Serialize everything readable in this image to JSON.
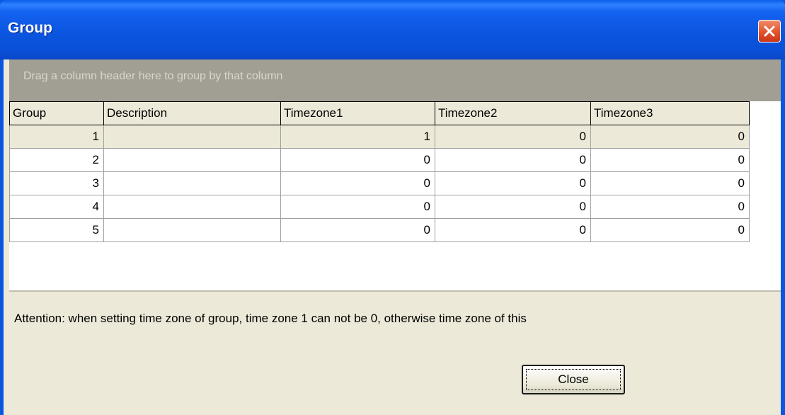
{
  "window": {
    "title": "Group"
  },
  "grid": {
    "group_panel_hint": "Drag a column header here to group by that column",
    "columns": [
      "Group",
      "Description",
      "Timezone1",
      "Timezone2",
      "Timezone3"
    ],
    "rows": [
      [
        "1",
        "",
        "1",
        "0",
        "0"
      ],
      [
        "2",
        "",
        "0",
        "0",
        "0"
      ],
      [
        "3",
        "",
        "0",
        "0",
        "0"
      ],
      [
        "4",
        "",
        "0",
        "0",
        "0"
      ],
      [
        "5",
        "",
        "0",
        "0",
        "0"
      ]
    ]
  },
  "notice": "Attention: when setting time zone of group, time zone 1 can not be 0, otherwise time zone of this",
  "buttons": {
    "close": "Close"
  },
  "colors": {
    "title_bar": "#0a54de",
    "close_button": "#e2532b",
    "dialog_background": "#ece9d8",
    "group_panel": "#a19f94"
  },
  "icons": {
    "title_close": "close-icon"
  }
}
